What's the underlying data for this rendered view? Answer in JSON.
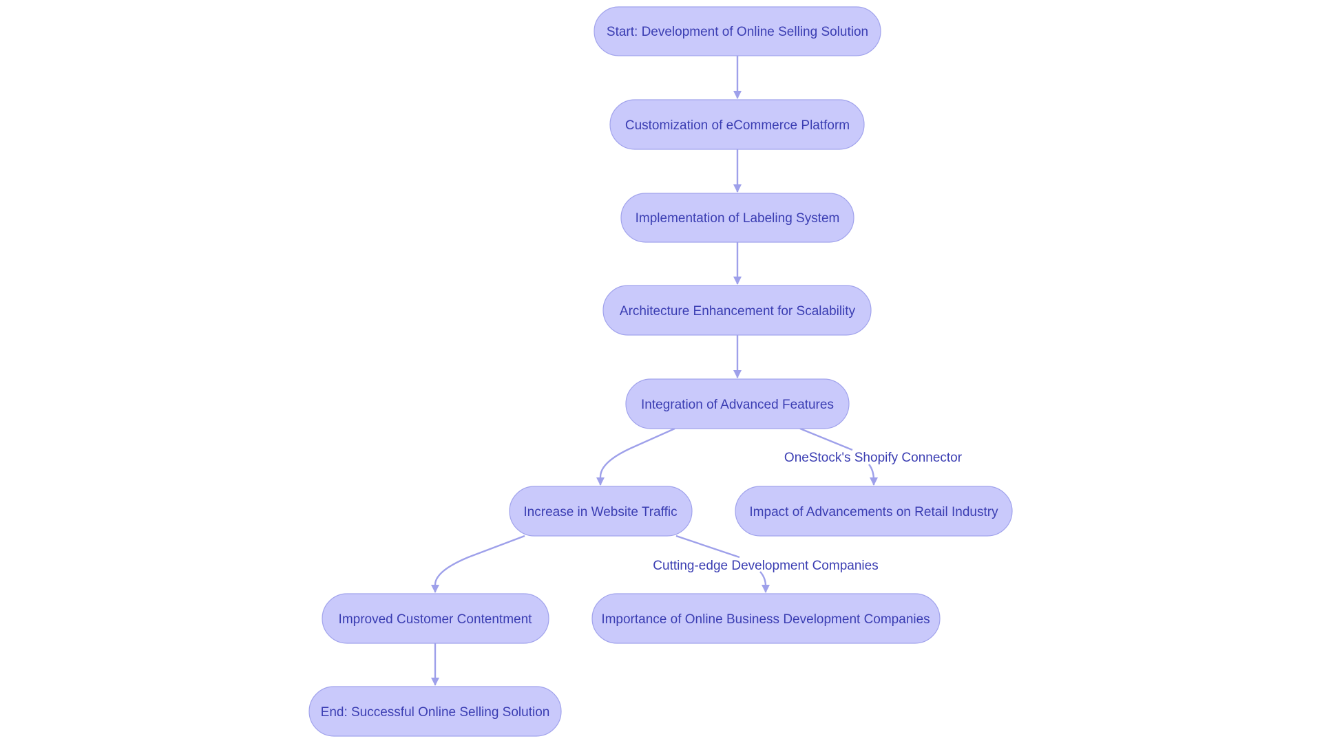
{
  "diagram": {
    "type": "flowchart",
    "colors": {
      "node_fill": "#c9c9fb",
      "node_stroke": "#a1a3ec",
      "edge": "#9ea0ea",
      "text": "#3a3db2",
      "background": "#ffffff"
    },
    "nodes": [
      {
        "id": "start",
        "label": "Start: Development of Online Selling Solution"
      },
      {
        "id": "customization",
        "label": "Customization of eCommerce Platform"
      },
      {
        "id": "labeling",
        "label": "Implementation of Labeling System"
      },
      {
        "id": "architecture",
        "label": "Architecture Enhancement for Scalability"
      },
      {
        "id": "integration",
        "label": "Integration of Advanced Features"
      },
      {
        "id": "traffic",
        "label": "Increase in Website Traffic"
      },
      {
        "id": "impact",
        "label": "Impact of Advancements on Retail Industry"
      },
      {
        "id": "contentment",
        "label": "Improved Customer Contentment"
      },
      {
        "id": "importance",
        "label": "Importance of Online Business Development Companies"
      },
      {
        "id": "end",
        "label": "End: Successful Online Selling Solution"
      }
    ],
    "edges": [
      {
        "from": "start",
        "to": "customization",
        "label": ""
      },
      {
        "from": "customization",
        "to": "labeling",
        "label": ""
      },
      {
        "from": "labeling",
        "to": "architecture",
        "label": ""
      },
      {
        "from": "architecture",
        "to": "integration",
        "label": ""
      },
      {
        "from": "integration",
        "to": "traffic",
        "label": ""
      },
      {
        "from": "integration",
        "to": "impact",
        "label": "OneStock's Shopify Connector"
      },
      {
        "from": "traffic",
        "to": "contentment",
        "label": ""
      },
      {
        "from": "traffic",
        "to": "importance",
        "label": "Cutting-edge Development Companies"
      },
      {
        "from": "contentment",
        "to": "end",
        "label": ""
      }
    ]
  }
}
